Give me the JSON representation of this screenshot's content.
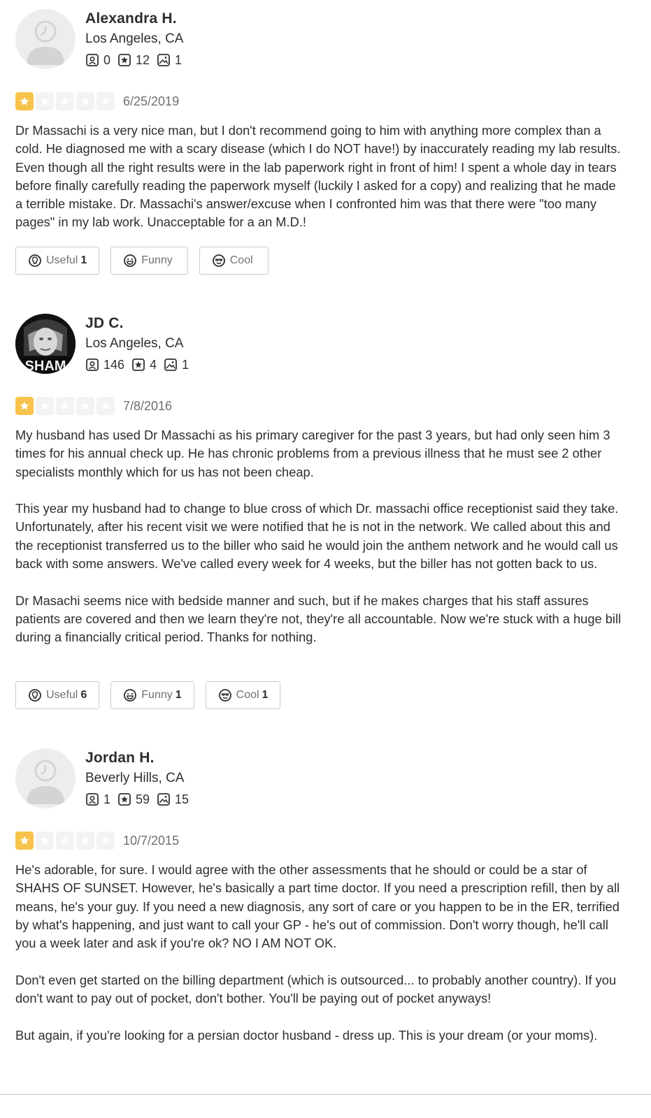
{
  "reviews": [
    {
      "user": {
        "name": "Alexandra H.",
        "location": "Los Angeles, CA",
        "friends": "0",
        "reviews": "12",
        "photos": "1",
        "avatar": "default"
      },
      "rating": 1,
      "date": "6/25/2019",
      "paragraphs": [
        "Dr Massachi is a very nice man, but I don't recommend going to him with anything more complex than a cold. He diagnosed me with a scary disease (which I do NOT have!) by inaccurately reading my lab results. Even though all the right results were in the lab paperwork right in front of him! I spent a whole day in tears before finally carefully reading the paperwork myself (luckily I asked for a copy) and realizing that he made a terrible mistake. Dr. Massachi's answer/excuse when I confronted him was that there were \"too many pages\" in my lab work. Unacceptable for a an M.D.!"
      ],
      "buttons": {
        "useful": {
          "label": "Useful",
          "count": "1"
        },
        "funny": {
          "label": "Funny",
          "count": ""
        },
        "cool": {
          "label": "Cool",
          "count": ""
        }
      }
    },
    {
      "user": {
        "name": "JD C.",
        "location": "Los Angeles, CA",
        "friends": "146",
        "reviews": "4",
        "photos": "1",
        "avatar": "photo",
        "avatar_text": "SHAM"
      },
      "rating": 1,
      "date": "7/8/2016",
      "paragraphs": [
        "My husband has used Dr Massachi as his primary caregiver for the past 3 years, but had only seen him 3 times for his annual check up. He has chronic problems from a previous illness that he must see 2 other specialists monthly which for us has not been cheap.",
        "This year my husband had to change to blue cross of which Dr. massachi office receptionist said they take. Unfortunately, after his recent visit we were notified that he is not in the network. We called about this and the receptionist transferred us to the biller who said he would join the anthem network and he would call us back with some answers. We've called every week for 4 weeks, but the biller has not gotten back to us.",
        "Dr Masachi seems nice with bedside manner and such, but if he makes charges that his staff assures patients are covered and then we learn they're not, they're all accountable. Now we're stuck with a huge bill during a financially critical period. Thanks for nothing."
      ],
      "buttons": {
        "useful": {
          "label": "Useful",
          "count": "6"
        },
        "funny": {
          "label": "Funny",
          "count": "1"
        },
        "cool": {
          "label": "Cool",
          "count": "1"
        }
      }
    },
    {
      "user": {
        "name": "Jordan H.",
        "location": "Beverly Hills, CA",
        "friends": "1",
        "reviews": "59",
        "photos": "15",
        "avatar": "default"
      },
      "rating": 1,
      "date": "10/7/2015",
      "paragraphs": [
        "He's adorable, for sure. I would agree with the other assessments that he should or could be a star of SHAHS OF SUNSET. However, he's basically a part time doctor. If you need a prescription refill, then by all means, he's your guy. If you need a new diagnosis, any sort of care or you happen to be in the ER, terrified by what's happening, and just want to call your GP - he's out of commission. Don't worry though, he'll call you a week later and ask if you're ok? NO I AM NOT OK.",
        "Don't even get started on the billing department (which is outsourced... to probably another country). If you don't want to pay out of pocket, don't bother. You'll be paying out of pocket anyways!",
        "But again, if you're looking for a persian doctor husband - dress up. This is your dream (or your moms)."
      ]
    }
  ],
  "colors": {
    "star_active": "#f7c34a",
    "star_inactive": "#f3f3f3",
    "text": "#2d2e2f",
    "muted": "#6e7072"
  }
}
